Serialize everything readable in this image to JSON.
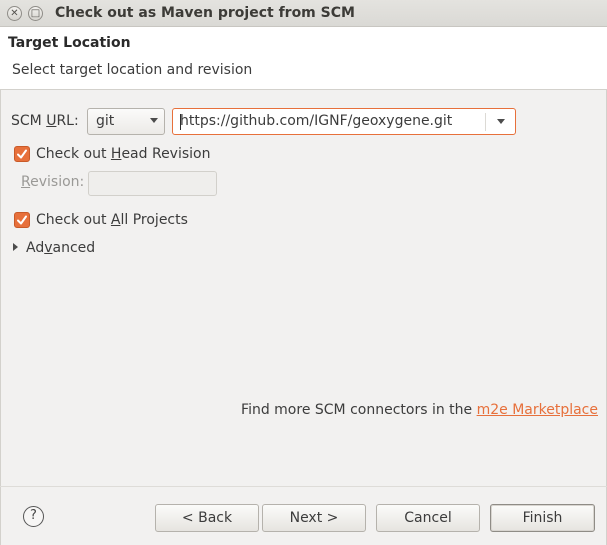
{
  "window": {
    "title": "Check out as Maven project from SCM",
    "close_glyph": "✕",
    "maximize_glyph": "□"
  },
  "header": {
    "title": "Target Location",
    "subtitle": "Select target location and revision"
  },
  "form": {
    "scm_url_label_pre": "SCM ",
    "scm_url_label_mnemonic": "U",
    "scm_url_label_post": "RL:",
    "scm_type": "git",
    "scm_url": "https://github.com/IGNF/geoxygene.git",
    "head_revision": {
      "checked": true,
      "label_pre": "Check out ",
      "label_mnemonic": "H",
      "label_post": "ead Revision"
    },
    "revision": {
      "label_mnemonic": "R",
      "label_post": "evision:",
      "value": ""
    },
    "all_projects": {
      "checked": true,
      "label_pre": "Check out ",
      "label_mnemonic": "A",
      "label_post": "ll Projects"
    },
    "advanced": {
      "label_pre": "Ad",
      "label_mnemonic": "v",
      "label_post": "anced",
      "expanded": false
    },
    "connectors_text": "Find more SCM connectors in the ",
    "connectors_link": "m2e Marketplace"
  },
  "footer": {
    "help_glyph": "?",
    "back_label": "< Back",
    "next_label": "Next >",
    "cancel_label": "Cancel",
    "finish_label": "Finish"
  },
  "colors": {
    "accent": "#e7703b",
    "background": "#f2f1f0"
  }
}
